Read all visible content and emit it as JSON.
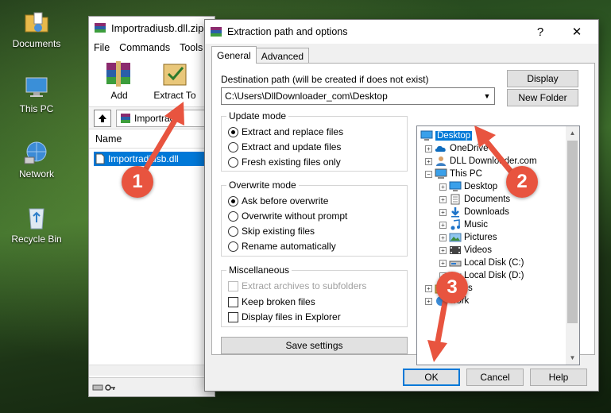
{
  "desktop": {
    "icons": [
      {
        "label": "Documents",
        "icon": "folder-documents-icon"
      },
      {
        "label": "This PC",
        "icon": "computer-icon"
      },
      {
        "label": "Network",
        "icon": "network-icon"
      },
      {
        "label": "Recycle Bin",
        "icon": "recycle-bin-icon"
      }
    ]
  },
  "winrar": {
    "title": "Importradiusb.dll.zip",
    "menu": [
      "File",
      "Commands",
      "Tools"
    ],
    "toolbar": [
      {
        "label": "Add",
        "icon": "add-archive-icon"
      },
      {
        "label": "Extract To",
        "icon": "extract-to-icon"
      }
    ],
    "path": "Importradiusb.dll.zip",
    "path_visible": "Importradiu",
    "column_name": "Name",
    "file": "Importradiusb.dll"
  },
  "dialog": {
    "title": "Extraction path and options",
    "help_glyph": "?",
    "close_glyph": "✕",
    "tabs": [
      {
        "label": "General",
        "active": true
      },
      {
        "label": "Advanced",
        "active": false
      }
    ],
    "destination_label": "Destination path (will be created if does not exist)",
    "destination_value": "C:\\Users\\DllDownloader_com\\Desktop",
    "display_button": "Display",
    "new_folder_button": "New Folder",
    "update_mode": {
      "title": "Update mode",
      "options": [
        {
          "label": "Extract and replace files",
          "checked": true
        },
        {
          "label": "Extract and update files",
          "checked": false
        },
        {
          "label": "Fresh existing files only",
          "checked": false
        }
      ]
    },
    "overwrite_mode": {
      "title": "Overwrite mode",
      "options": [
        {
          "label": "Ask before overwrite",
          "checked": true
        },
        {
          "label": "Overwrite without prompt",
          "checked": false
        },
        {
          "label": "Skip existing files",
          "checked": false
        },
        {
          "label": "Rename automatically",
          "checked": false
        }
      ]
    },
    "misc": {
      "title": "Miscellaneous",
      "options": [
        {
          "label": "Extract archives to subfolders",
          "checked": false,
          "disabled": true
        },
        {
          "label": "Keep broken files",
          "checked": false,
          "disabled": false
        },
        {
          "label": "Display files in Explorer",
          "checked": false,
          "disabled": false
        }
      ]
    },
    "save_settings_button": "Save settings",
    "tree": [
      {
        "label": "Desktop",
        "level": 0,
        "selected": true,
        "expander": false,
        "icon": "desktop-icon"
      },
      {
        "label": "OneDrive",
        "level": 1,
        "selected": false,
        "expander": true,
        "icon": "onedrive-icon"
      },
      {
        "label": "DLL Downloader.com",
        "level": 1,
        "selected": false,
        "expander": true,
        "icon": "user-icon"
      },
      {
        "label": "This PC",
        "level": 1,
        "selected": false,
        "expander": "open",
        "icon": "computer-icon"
      },
      {
        "label": "Desktop",
        "level": 2,
        "selected": false,
        "expander": true,
        "icon": "desktop-icon"
      },
      {
        "label": "Documents",
        "level": 2,
        "selected": false,
        "expander": true,
        "icon": "documents-icon"
      },
      {
        "label": "Downloads",
        "level": 2,
        "selected": false,
        "expander": true,
        "icon": "downloads-icon"
      },
      {
        "label": "Music",
        "level": 2,
        "selected": false,
        "expander": true,
        "icon": "music-icon"
      },
      {
        "label": "Pictures",
        "level": 2,
        "selected": false,
        "expander": true,
        "icon": "pictures-icon"
      },
      {
        "label": "Videos",
        "level": 2,
        "selected": false,
        "expander": true,
        "icon": "videos-icon"
      },
      {
        "label": "Local Disk (C:)",
        "level": 2,
        "selected": false,
        "expander": true,
        "icon": "drive-icon"
      },
      {
        "label": "Local Disk (D:)",
        "level": 2,
        "selected": false,
        "expander": true,
        "icon": "drive-icon"
      },
      {
        "label": "raries",
        "level": 1,
        "selected": false,
        "expander": true,
        "icon": "libraries-icon"
      },
      {
        "label": "work",
        "level": 1,
        "selected": false,
        "expander": true,
        "icon": "network-icon"
      }
    ],
    "ok_button": "OK",
    "cancel_button": "Cancel",
    "help_button": "Help"
  },
  "annotations": {
    "badges": [
      "1",
      "2",
      "3"
    ],
    "color": "#e8543f"
  },
  "colors": {
    "selection": "#0078d7",
    "dialog_bg": "#f0f0f0",
    "annotation": "#e8543f"
  }
}
